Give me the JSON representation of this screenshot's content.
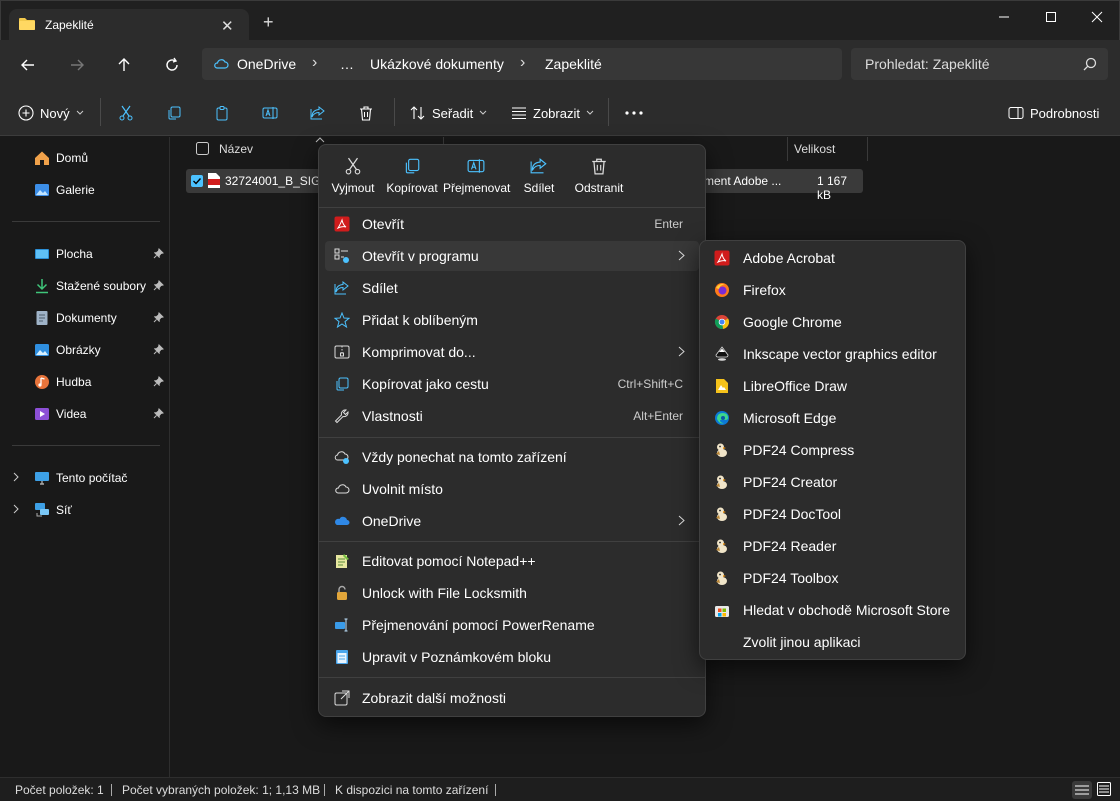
{
  "window": {
    "tab_title": "Zapeklité",
    "tab_icon": "folder-icon",
    "new_tab": "+"
  },
  "nav": {
    "breadcrumb": [
      "OneDrive",
      "…",
      "Ukázkové dokumenty",
      "Zapeklité"
    ],
    "search_placeholder": "Prohledat: Zapeklité"
  },
  "toolbar": {
    "new_label": "Nový",
    "sort_label": "Seřadit",
    "view_label": "Zobrazit",
    "details_label": "Podrobnosti"
  },
  "sidebar": {
    "items": [
      {
        "label": "Domů",
        "icon": "home-icon"
      },
      {
        "label": "Galerie",
        "icon": "gallery-icon"
      },
      {
        "label": "Plocha",
        "icon": "desktop-icon"
      },
      {
        "label": "Stažené soubory",
        "icon": "download-icon"
      },
      {
        "label": "Dokumenty",
        "icon": "documents-icon"
      },
      {
        "label": "Obrázky",
        "icon": "pictures-icon"
      },
      {
        "label": "Hudba",
        "icon": "music-icon"
      },
      {
        "label": "Videa",
        "icon": "videos-icon"
      },
      {
        "label": "Tento počítač",
        "icon": "pc-icon"
      },
      {
        "label": "Síť",
        "icon": "network-icon"
      }
    ]
  },
  "filelist": {
    "columns": [
      "Název",
      "Velikost"
    ],
    "row": {
      "name": "32724001_B_SIG.p",
      "type": "ment Adobe ...",
      "size": "1 167 kB"
    }
  },
  "context_menu": {
    "quick_actions": [
      "Vyjmout",
      "Kopírovat",
      "Přejmenovat",
      "Sdílet",
      "Odstranit"
    ],
    "items": [
      {
        "label": "Otevřít",
        "accel": "Enter",
        "icon": "pdf-icon"
      },
      {
        "label": "Otevřít v programu",
        "accel": "",
        "icon": "open-with-icon"
      },
      {
        "label": "Sdílet",
        "accel": "",
        "icon": "share-icon"
      },
      {
        "label": "Přidat k oblíbeným",
        "accel": "",
        "icon": "star-icon"
      },
      {
        "label": "Komprimovat do...",
        "accel": "",
        "icon": "zip-icon"
      },
      {
        "label": "Kopírovat jako cestu",
        "accel": "Ctrl+Shift+C",
        "icon": "copy-path-icon"
      },
      {
        "label": "Vlastnosti",
        "accel": "Alt+Enter",
        "icon": "wrench-icon"
      },
      {
        "label": "Vždy ponechat na tomto zařízení",
        "accel": "",
        "icon": "cloud-sync-icon"
      },
      {
        "label": "Uvolnit místo",
        "accel": "",
        "icon": "cloud-icon"
      },
      {
        "label": "OneDrive",
        "accel": "",
        "icon": "onedrive-icon"
      },
      {
        "label": "Editovat pomocí Notepad++",
        "accel": "",
        "icon": "notepadpp-icon"
      },
      {
        "label": "Unlock with File Locksmith",
        "accel": "",
        "icon": "lock-icon"
      },
      {
        "label": "Přejmenování pomocí PowerRename",
        "accel": "",
        "icon": "powerrename-icon"
      },
      {
        "label": "Upravit v Poznámkovém bloku",
        "accel": "",
        "icon": "notepad-icon"
      },
      {
        "label": "Zobrazit další možnosti",
        "accel": "",
        "icon": "more-options-icon"
      }
    ]
  },
  "submenu": {
    "items": [
      {
        "label": "Adobe Acrobat",
        "icon": "acrobat-icon"
      },
      {
        "label": "Firefox",
        "icon": "firefox-icon"
      },
      {
        "label": "Google Chrome",
        "icon": "chrome-icon"
      },
      {
        "label": "Inkscape vector graphics editor",
        "icon": "inkscape-icon"
      },
      {
        "label": "LibreOffice Draw",
        "icon": "libreoffice-draw-icon"
      },
      {
        "label": "Microsoft Edge",
        "icon": "edge-icon"
      },
      {
        "label": "PDF24 Compress",
        "icon": "pdf24-icon"
      },
      {
        "label": "PDF24 Creator",
        "icon": "pdf24-icon"
      },
      {
        "label": "PDF24 DocTool",
        "icon": "pdf24-icon"
      },
      {
        "label": "PDF24 Reader",
        "icon": "pdf24-icon"
      },
      {
        "label": "PDF24 Toolbox",
        "icon": "pdf24-icon"
      },
      {
        "label": "Hledat v obchodě Microsoft Store",
        "icon": "store-icon"
      },
      {
        "label": "Zvolit jinou aplikaci",
        "icon": ""
      }
    ]
  },
  "status": {
    "count": "Počet položek: 1",
    "selected": "Počet vybraných položek: 1; 1,13 MB",
    "availability": "K dispozici na tomto zařízení"
  },
  "colors": {
    "accent": "#4cc2ff",
    "pdf_red": "#d01c1c",
    "background": "#191919",
    "menu_bg": "#2c2c2c"
  }
}
